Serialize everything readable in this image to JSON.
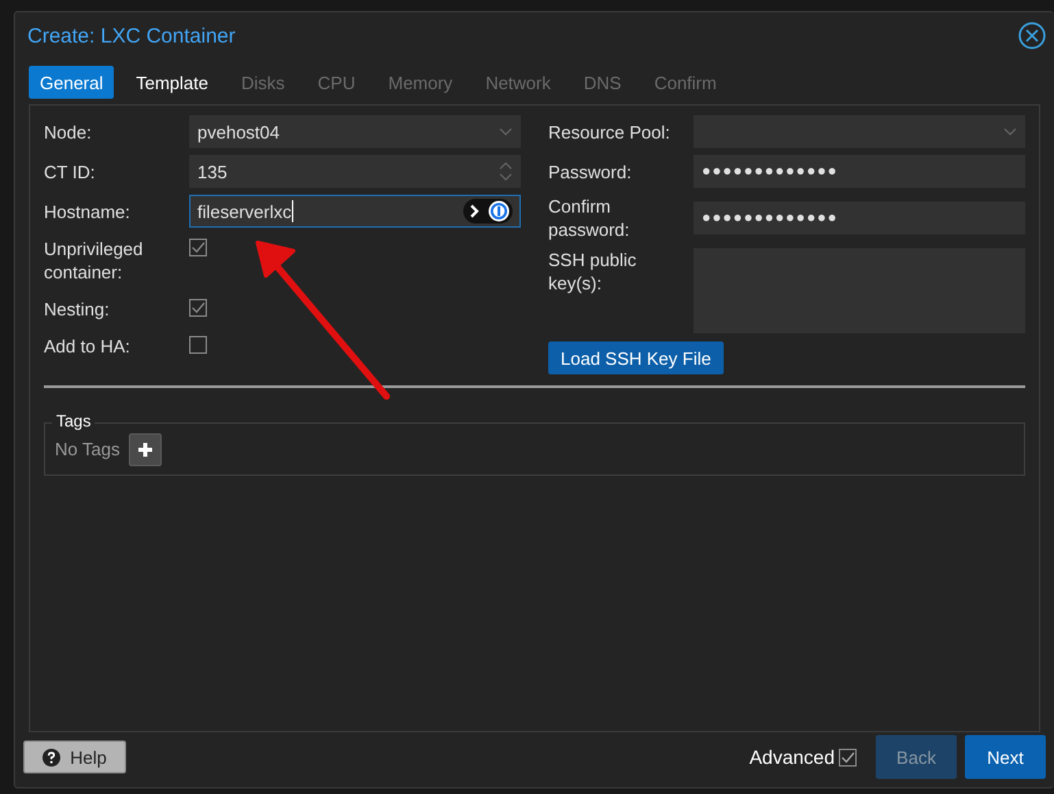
{
  "dialog": {
    "title": "Create: LXC Container"
  },
  "tabs": [
    {
      "label": "General",
      "selected": true,
      "disabled": false
    },
    {
      "label": "Template",
      "selected": false,
      "disabled": false
    },
    {
      "label": "Disks",
      "selected": false,
      "disabled": true
    },
    {
      "label": "CPU",
      "selected": false,
      "disabled": true
    },
    {
      "label": "Memory",
      "selected": false,
      "disabled": true
    },
    {
      "label": "Network",
      "selected": false,
      "disabled": true
    },
    {
      "label": "DNS",
      "selected": false,
      "disabled": true
    },
    {
      "label": "Confirm",
      "selected": false,
      "disabled": true
    }
  ],
  "left_fields": [
    {
      "kind": "combo",
      "label": "Node:",
      "value": "pvehost04"
    },
    {
      "kind": "spinner",
      "label": "CT ID:",
      "value": "135"
    },
    {
      "kind": "text",
      "label": "Hostname:",
      "value": "fileserverlxc",
      "focused": true
    },
    {
      "kind": "checkbox",
      "label": "Unprivileged container:",
      "checked": true
    },
    {
      "kind": "checkbox",
      "label": "Nesting:",
      "checked": true
    },
    {
      "kind": "checkbox",
      "label": "Add to HA:",
      "checked": false
    }
  ],
  "right_fields": [
    {
      "kind": "combo",
      "label": "Resource Pool:"
    },
    {
      "kind": "password",
      "label": "Password:",
      "value": "●●●●●●●●●●●●●"
    },
    {
      "kind": "password",
      "label": "Confirm password:",
      "value": "●●●●●●●●●●●●●"
    },
    {
      "kind": "textarea",
      "label": "SSH public key(s):"
    }
  ],
  "load_button": {
    "label": "Load SSH Key File"
  },
  "tags": {
    "legend": "Tags",
    "empty_text": "No Tags"
  },
  "footer": {
    "help": {
      "label": "Help"
    },
    "advanced": {
      "label": "Advanced",
      "checked": true
    },
    "back": {
      "label": "Back",
      "disabled": true
    },
    "next": {
      "label": "Next",
      "disabled": false
    }
  }
}
